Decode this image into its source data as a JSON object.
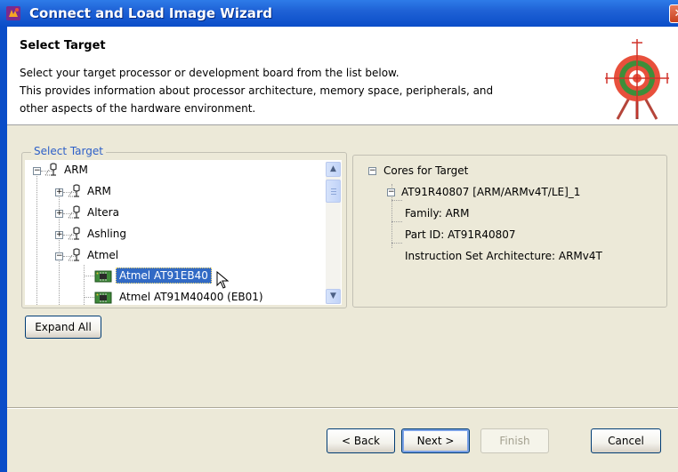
{
  "window": {
    "title": "Connect and Load Image Wizard",
    "close_glyph": "✕"
  },
  "header": {
    "title": "Select Target",
    "description": [
      "Select your target processor or development board from the list below.",
      "This provides information about processor architecture, memory space, peripherals, and",
      "other aspects of the hardware environment."
    ]
  },
  "select_target": {
    "legend": "Select Target",
    "tree": [
      {
        "label": "ARM",
        "level": 0,
        "expander": "⊟",
        "icon": "target-folder-icon"
      },
      {
        "label": "ARM",
        "level": 1,
        "expander": "⊞",
        "icon": "target-folder-icon"
      },
      {
        "label": "Altera",
        "level": 1,
        "expander": "⊞",
        "icon": "target-folder-icon"
      },
      {
        "label": "Ashling",
        "level": 1,
        "expander": "⊞",
        "icon": "target-folder-icon"
      },
      {
        "label": "Atmel",
        "level": 1,
        "expander": "⊟",
        "icon": "target-folder-icon"
      },
      {
        "label": "Atmel AT91EB40",
        "level": 2,
        "selected": true,
        "icon": "board-chip-icon"
      },
      {
        "label": "Atmel AT91M40400 (EB01)",
        "level": 2,
        "icon": "board-chip-icon"
      }
    ],
    "expand_all_label": "Expand All"
  },
  "details": {
    "root": "Cores for Target",
    "core": "AT91R40807 [ARM/ARMv4T/LE]_1",
    "properties": [
      "Family: ARM",
      "Part ID: AT91R40807",
      "Instruction Set Architecture: ARMv4T"
    ]
  },
  "footer": {
    "back_label": "< Back",
    "next_label": "Next >",
    "finish_label": "Finish",
    "cancel_label": "Cancel"
  },
  "colors": {
    "titlebar": "#0A4DC8",
    "selection": "#316AC5",
    "face": "#ECE9D8",
    "legend": "#2E60C8"
  }
}
